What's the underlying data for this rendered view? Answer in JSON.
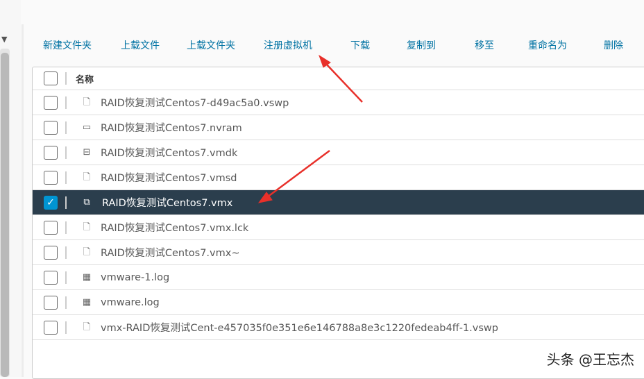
{
  "toolbar": {
    "items": [
      "新建文件夹",
      "上载文件",
      "上载文件夹",
      "注册虚拟机",
      "下载",
      "复制到",
      "移至",
      "重命名为",
      "删除"
    ]
  },
  "table": {
    "header": "名称",
    "rows": [
      {
        "name": "RAID恢复测试Centos7-d49ac5a0.vswp",
        "icon": "file-icon",
        "selected": false
      },
      {
        "name": "RAID恢复测试Centos7.nvram",
        "icon": "nvram-icon",
        "selected": false
      },
      {
        "name": "RAID恢复测试Centos7.vmdk",
        "icon": "disk-icon",
        "selected": false
      },
      {
        "name": "RAID恢复测试Centos7.vmsd",
        "icon": "file-icon",
        "selected": false
      },
      {
        "name": "RAID恢复测试Centos7.vmx",
        "icon": "vm-icon",
        "selected": true
      },
      {
        "name": "RAID恢复测试Centos7.vmx.lck",
        "icon": "file-icon",
        "selected": false
      },
      {
        "name": "RAID恢复测试Centos7.vmx~",
        "icon": "file-icon",
        "selected": false
      },
      {
        "name": "vmware-1.log",
        "icon": "log-icon",
        "selected": false
      },
      {
        "name": "vmware.log",
        "icon": "log-icon",
        "selected": false
      },
      {
        "name": "vmx-RAID恢复测试Cent-e457035f0e351e6e146788a8e3c1220fedeab4ff-1.vswp",
        "icon": "file-icon",
        "selected": false
      }
    ]
  },
  "watermark": "头条 @王忘杰",
  "colors": {
    "accent": "#0072a3",
    "selected_row": "#2b3e4d",
    "arrow": "#e8302a"
  }
}
